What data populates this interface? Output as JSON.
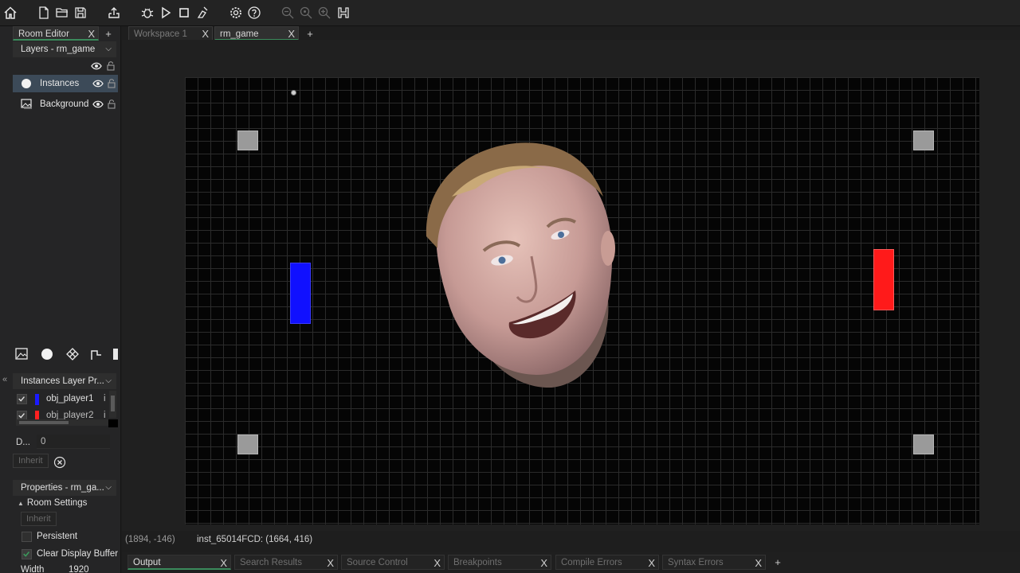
{
  "toolbar": {
    "icons": [
      "home-icon",
      "new-file-icon",
      "open-folder-icon",
      "save-icon",
      "export-icon",
      "debug-icon",
      "run-icon",
      "stop-icon",
      "clean-icon",
      "settings-icon",
      "help-icon",
      "zoom-out-icon",
      "zoom-reset-icon",
      "zoom-in-icon",
      "gamepad-icon"
    ]
  },
  "left_tabs": {
    "room_editor": "Room Editor",
    "plus": "+"
  },
  "layers": {
    "header": "Layers - rm_game",
    "items": [
      {
        "label": "Instances",
        "icon": "instance-layer-icon"
      },
      {
        "label": "Background",
        "icon": "background-layer-icon"
      }
    ]
  },
  "instances_panel": {
    "header": "Instances Layer Pr...",
    "rows": [
      {
        "name": "obj_player1",
        "suffix": "i",
        "color": "#1a1aff"
      },
      {
        "name": "obj_player2",
        "suffix": "i",
        "color": "#ff2020"
      }
    ],
    "depth_label": "D...",
    "depth_value": "0",
    "inherit_label": "Inherit"
  },
  "properties": {
    "header": "Properties - rm_ga...",
    "room_settings": "Room Settings",
    "inherit_label": "Inherit",
    "persistent_label": "Persistent",
    "clear_display_label": "Clear Display Buffer",
    "width_label": "Width",
    "width_value": "1920"
  },
  "editor_tabs": [
    {
      "label": "Workspace 1",
      "active": false
    },
    {
      "label": "rm_game",
      "active": true
    }
  ],
  "editor_plus": "+",
  "room": {
    "blocks": 4,
    "paddle_left_color": "#1010ff",
    "paddle_right_color": "#ff1a1a"
  },
  "status": {
    "cursor": "(1894, -146)",
    "instance": "inst_65014FCD: (1664, 416)"
  },
  "bottom_tabs": [
    {
      "label": "Output",
      "active": true
    },
    {
      "label": "Search Results",
      "active": false
    },
    {
      "label": "Source Control",
      "active": false
    },
    {
      "label": "Breakpoints",
      "active": false
    },
    {
      "label": "Compile Errors",
      "active": false
    },
    {
      "label": "Syntax Errors",
      "active": false
    }
  ],
  "bottom_plus": "+",
  "close_glyph": "X",
  "collapse_glyph": "«"
}
